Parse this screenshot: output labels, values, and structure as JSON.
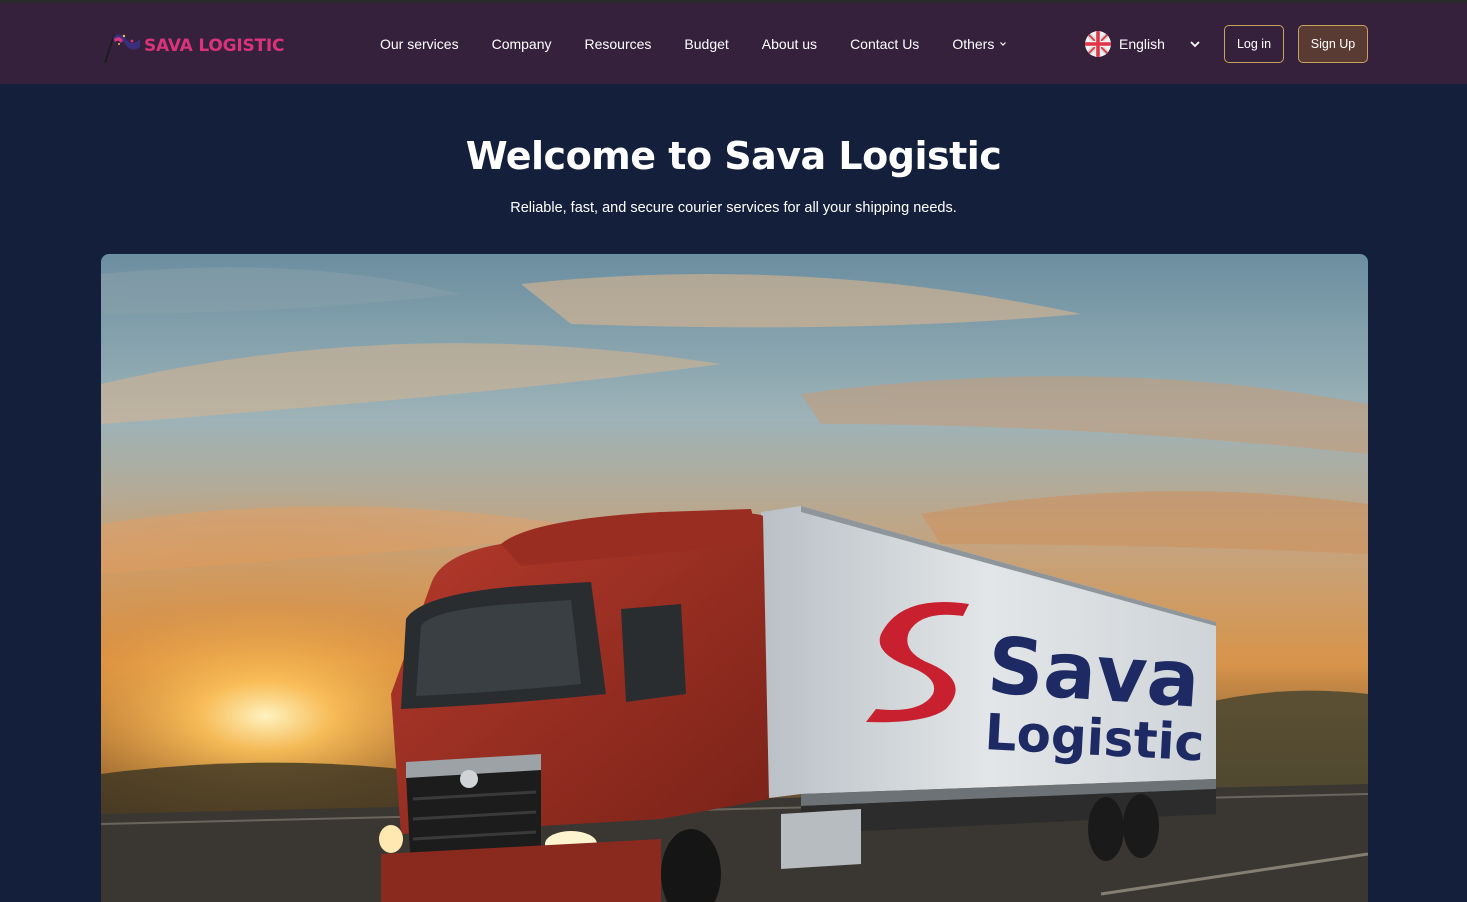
{
  "brand": {
    "name": "SAVA LOGISTIC",
    "color": "#d9337a"
  },
  "nav": {
    "items": [
      {
        "label": "Our services"
      },
      {
        "label": "Company"
      },
      {
        "label": "Resources"
      },
      {
        "label": "Budget"
      },
      {
        "label": "About us"
      },
      {
        "label": "Contact Us"
      },
      {
        "label": "Others",
        "icon": "chevron-down-icon"
      }
    ]
  },
  "language": {
    "selected": "English",
    "icon": "uk-flag-icon"
  },
  "auth": {
    "login_label": "Log in",
    "signup_label": "Sign Up"
  },
  "hero": {
    "title": "Welcome to Sava Logistic",
    "subtitle": "Reliable, fast, and secure courier services for all your shipping needs.",
    "truck_text_line1": "Sava",
    "truck_text_line2": "Logistic"
  },
  "colors": {
    "navbar": "#36213d",
    "background": "#14203b",
    "button_border": "#c9a25c",
    "signup_bg": "#5a3b33"
  }
}
